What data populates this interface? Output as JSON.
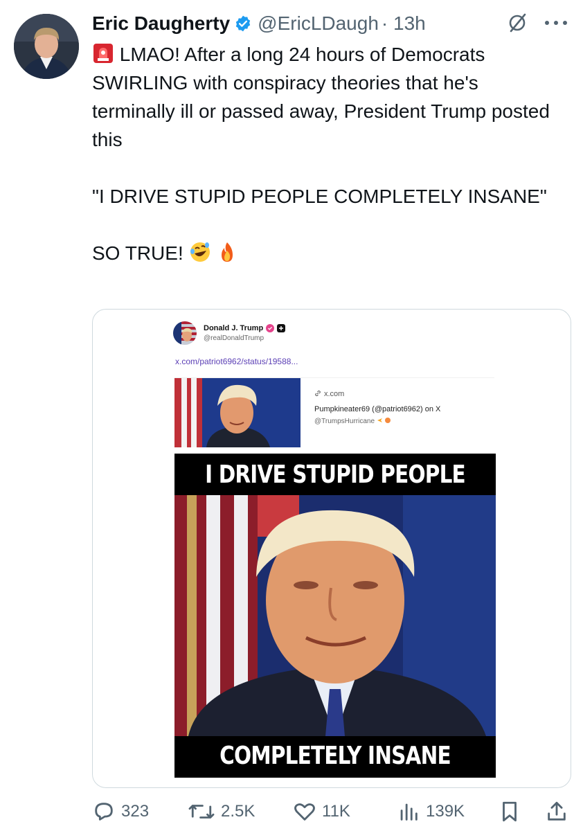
{
  "author": {
    "name": "Eric Daugherty",
    "handle": "@EricLDaugh",
    "time": "· 13h",
    "verified": true,
    "avatar_icon": "profile-photo"
  },
  "tweet": {
    "line1": "LMAO! After a long 24 hours of Democrats SWIRLING with conspiracy theories that he's terminally ill or passed away, President Trump posted this",
    "line2": "\"I DRIVE STUPID PEOPLE COMPLETELY INSANE\"",
    "line3": "SO TRUE!",
    "emojis": [
      "siren-emoji",
      "rofl-emoji",
      "fire-emoji"
    ]
  },
  "embedded": {
    "name": "Donald J. Trump",
    "handle": "@realDonaldTrump",
    "link": "x.com/patriot6962/status/19588...",
    "card": {
      "site": "x.com",
      "title": "Pumpkineater69 (@patriot6962) on X",
      "subtitle": "@TrumpsHurricane"
    },
    "meme_top": "I DRIVE STUPID PEOPLE",
    "meme_bottom": "COMPLETELY INSANE"
  },
  "actions": {
    "replies": "323",
    "reposts": "2.5K",
    "likes": "11K",
    "views": "139K"
  },
  "colors": {
    "text": "#0f1419",
    "secondary": "#536471",
    "verified": "#1d9bf0",
    "border": "#cfd9de",
    "link": "#5b3fb5"
  }
}
